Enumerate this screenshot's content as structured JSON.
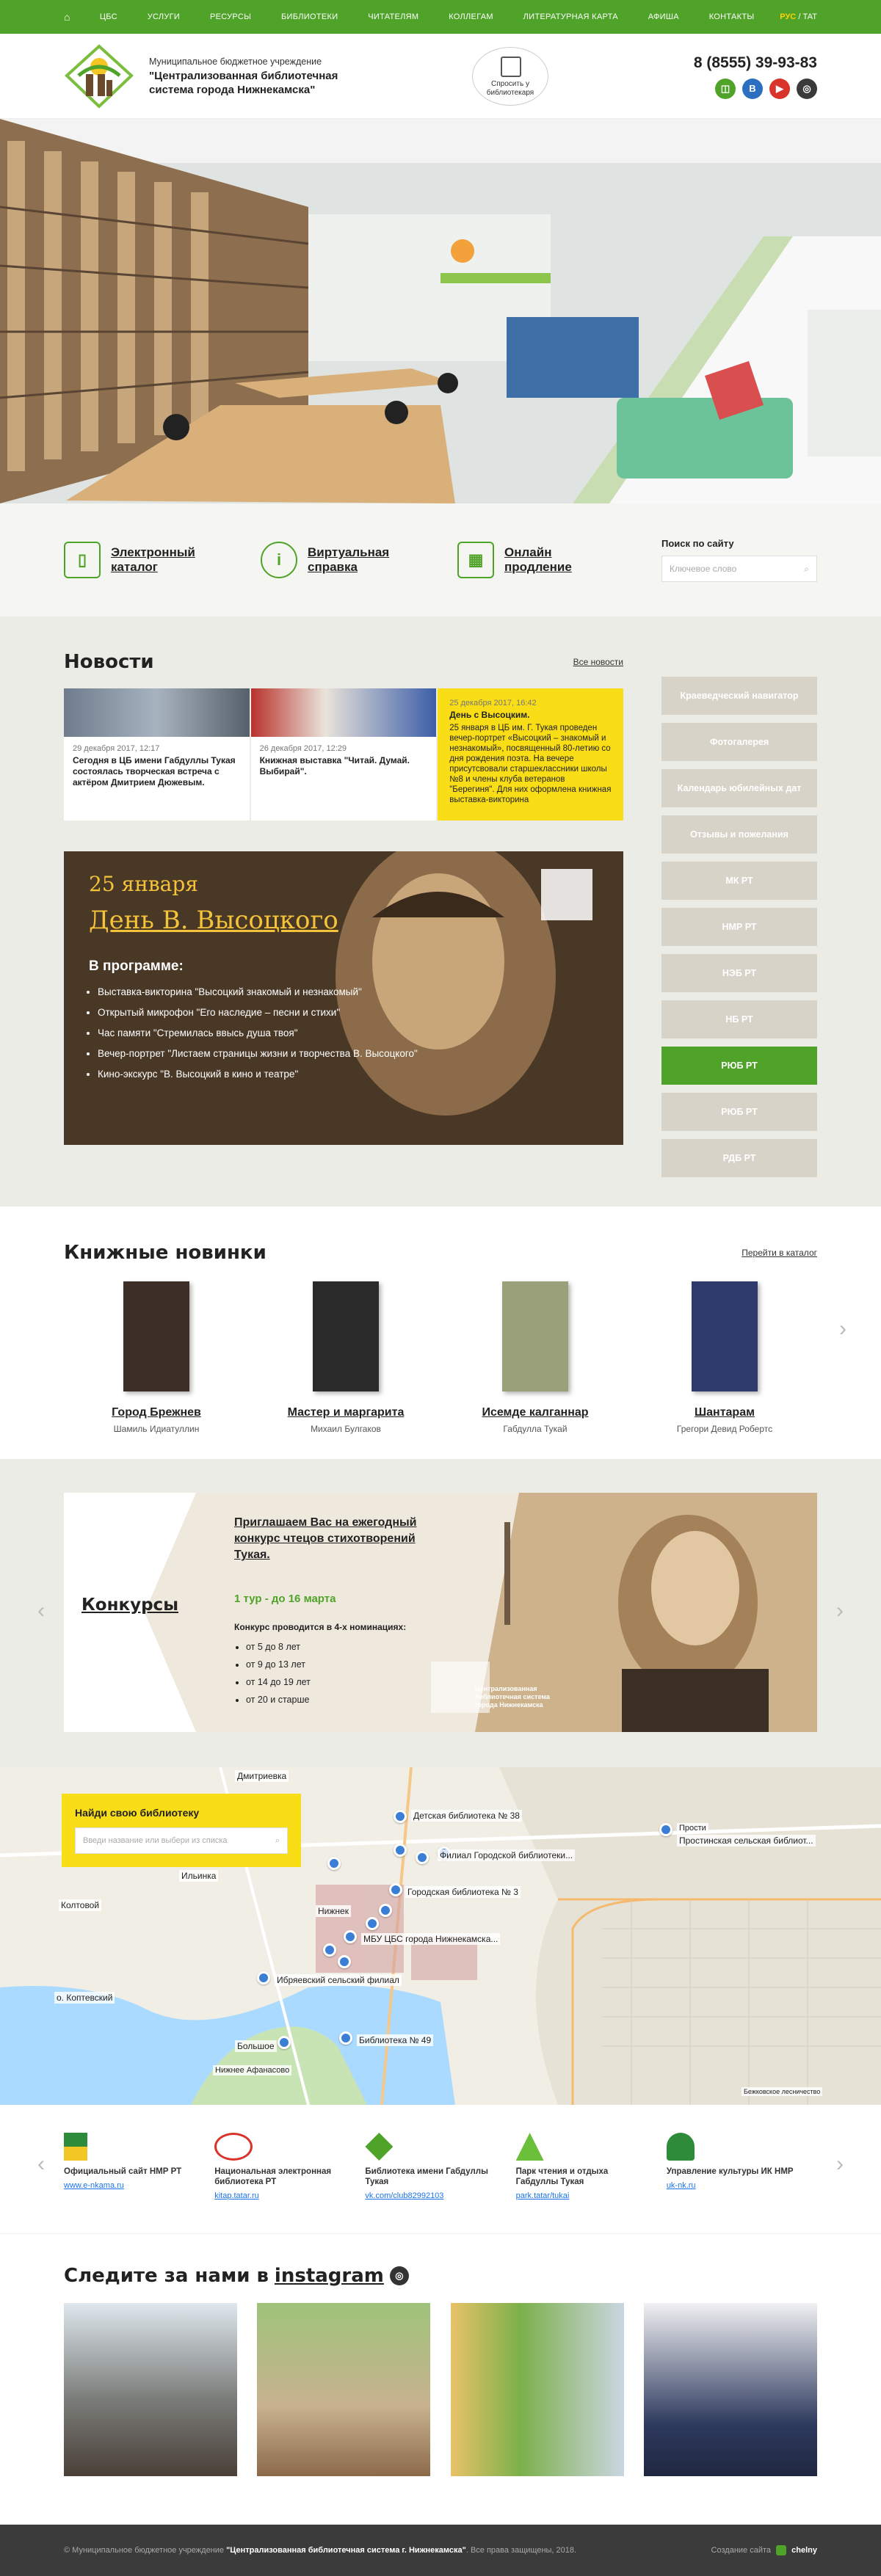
{
  "nav": {
    "items": [
      "ЦБС",
      "УСЛУГИ",
      "РЕСУРСЫ",
      "БИБЛИОТЕКИ",
      "ЧИТАТЕЛЯМ",
      "КОЛЛЕГАМ",
      "ЛИТЕРАТУРНАЯ  КАРТА",
      "АФИША",
      "КОНТАКТЫ"
    ],
    "lang_active": "РУС",
    "lang_sep": "/",
    "lang_other": "ТАТ"
  },
  "header": {
    "org_type": "Муниципальное бюджетное учреждение",
    "org_name": "\"Централизованная библиотечная система города Нижнекамска\"",
    "ask_label": "Спросить у библиотекаря",
    "phone": "8 (8555) 39-93-83",
    "socials": [
      "ok-icon",
      "vk-icon",
      "youtube-icon",
      "instagram-icon"
    ]
  },
  "quick": {
    "links": [
      {
        "label": "Электронный каталог",
        "icon": "tablet-icon"
      },
      {
        "label": "Виртуальная справка",
        "icon": "info-icon"
      },
      {
        "label": "Онлайн продление",
        "icon": "calendar-icon"
      }
    ],
    "search_label": "Поиск по сайту",
    "search_placeholder": "Ключевое слово"
  },
  "news": {
    "title": "Новости",
    "all_link": "Все новости",
    "cards": [
      {
        "date": "29 декабря 2017, 12:17",
        "title": "Сегодня в ЦБ имени Габдуллы Тукая состоялась творческая встреча с актёром Дмитрием Дюжевым."
      },
      {
        "date": "26 декабря 2017, 12:29",
        "title": "Книжная выставка \"Читай. Думай. Выбирай\"."
      },
      {
        "date": "25 декабря 2017, 16:42",
        "title": "День с Высоцким.",
        "text": "25 января в ЦБ им. Г. Тукая проведен вечер-портрет «Высоцкий – знакомый и незнакомый», посвященный 80-летию со дня рождения поэта. На вечере присутсвовали старшеклассники школы №8 и члены клуба ветеранов \"Берегиня\". Для них оформлена книжная выставка-викторина"
      }
    ],
    "banner": {
      "date": "25 января",
      "title": "День В. Высоцкого",
      "subtitle": "В программе:",
      "items": [
        "Выставка-викторина \"Высоцкий знакомый и незнакомый\"",
        "Открытый микрофон \"Его наследие – песни и стихи\"",
        "Час памяти \"Стремилась ввысь душа твоя\"",
        "Вечер-портрет \"Листаем страницы жизни и творчества В. Высоцкого\"",
        "Кино-экскурс \"В. Высоцкий в кино и театре\""
      ]
    }
  },
  "side": {
    "buttons": [
      "Краеведческий навигатор",
      "Фотогалерея",
      "Календарь юбилейных дат",
      "Отзывы и пожелания",
      "МК РТ",
      "НМР РТ",
      "НЭБ РТ",
      "НБ РТ",
      "РЮБ РТ",
      "РЮБ РТ",
      "РДБ РТ"
    ],
    "active_index": 8
  },
  "books": {
    "title": "Книжные новинки",
    "catalog_link": "Перейти в каталог",
    "items": [
      {
        "title": "Город Брежнев",
        "author": "Шамиль Идиатуллин",
        "color": "#3b2f28"
      },
      {
        "title": "Мастер и маргарита",
        "author": "Михаил Булгаков",
        "color": "#2a2a2a"
      },
      {
        "title": "Исемде калганнар",
        "author": "Габдулла Тукай",
        "color": "#9aa07a"
      },
      {
        "title": "Шантарам",
        "author": "Грегори Девид Робертс",
        "color": "#2d3a6b"
      }
    ]
  },
  "contests": {
    "label": "Конкурсы",
    "invite": "Приглашаем Вас на ежегодный конкурс чтецов стихотворений Тукая.",
    "round": "1 тур - до 16 марта",
    "nominations_title": "Конкурс проводится в 4-х номинациях:",
    "nominations": [
      "от 5 до 8 лет",
      "от 9 до 13 лет",
      "от 14 до 19 лет",
      "от 20 и старше"
    ],
    "seal_text": "Централизованная библиотечная система города Нижнекамска"
  },
  "map": {
    "finder_title": "Найди свою библиотеку",
    "finder_placeholder": "Введи название или выбери из списка",
    "places": [
      "Дмитриевка",
      "Ильинка",
      "Колтовой",
      "о. Коптевский",
      "Нижнек",
      "Большое",
      "Нижнее Афанасово",
      "Бежковское лесничество",
      "Прости"
    ],
    "pins": [
      {
        "label": "Детская библиотека № 38"
      },
      {
        "label": "Филиал Городской библиотеки..."
      },
      {
        "label": "Городская библиотека № 3"
      },
      {
        "label": "МБУ ЦБС города Нижнекамска..."
      },
      {
        "label": "Ибряевский сельский филиал"
      },
      {
        "label": "Библиотека № 49"
      },
      {
        "label": "Простинская сельская библиот..."
      }
    ]
  },
  "partners": [
    {
      "name": "Официальный сайт НМР РТ",
      "link": "www.e-nkama.ru"
    },
    {
      "name": "Национальная электронная библиотека РТ",
      "link": "kitap.tatar.ru"
    },
    {
      "name": "Библиотека имени Габдуллы Тукая",
      "link": "vk.com/club82992103"
    },
    {
      "name": "Парк чтения и отдыха Габдуллы Тукая",
      "link": "park.tatar/tukai"
    },
    {
      "name": "Управление культуры ИК НМР",
      "link": "uk-nk.ru"
    }
  ],
  "instagram": {
    "title_prefix": "Следите за нами в",
    "title_link": "instagram"
  },
  "footer": {
    "copyright_prefix": "© Муниципальное бюджетное учреждение",
    "copyright_org": "\"Централизованная библиотечная система г. Нижнекамска\"",
    "copyright_suffix": ". Все права защищены, 2018.",
    "made_by_label": "Создание сайта",
    "made_by": "chelny"
  },
  "colors": {
    "brand_green": "#4fa329",
    "accent_yellow": "#f9dd17",
    "bg_beige": "#ecece7"
  }
}
